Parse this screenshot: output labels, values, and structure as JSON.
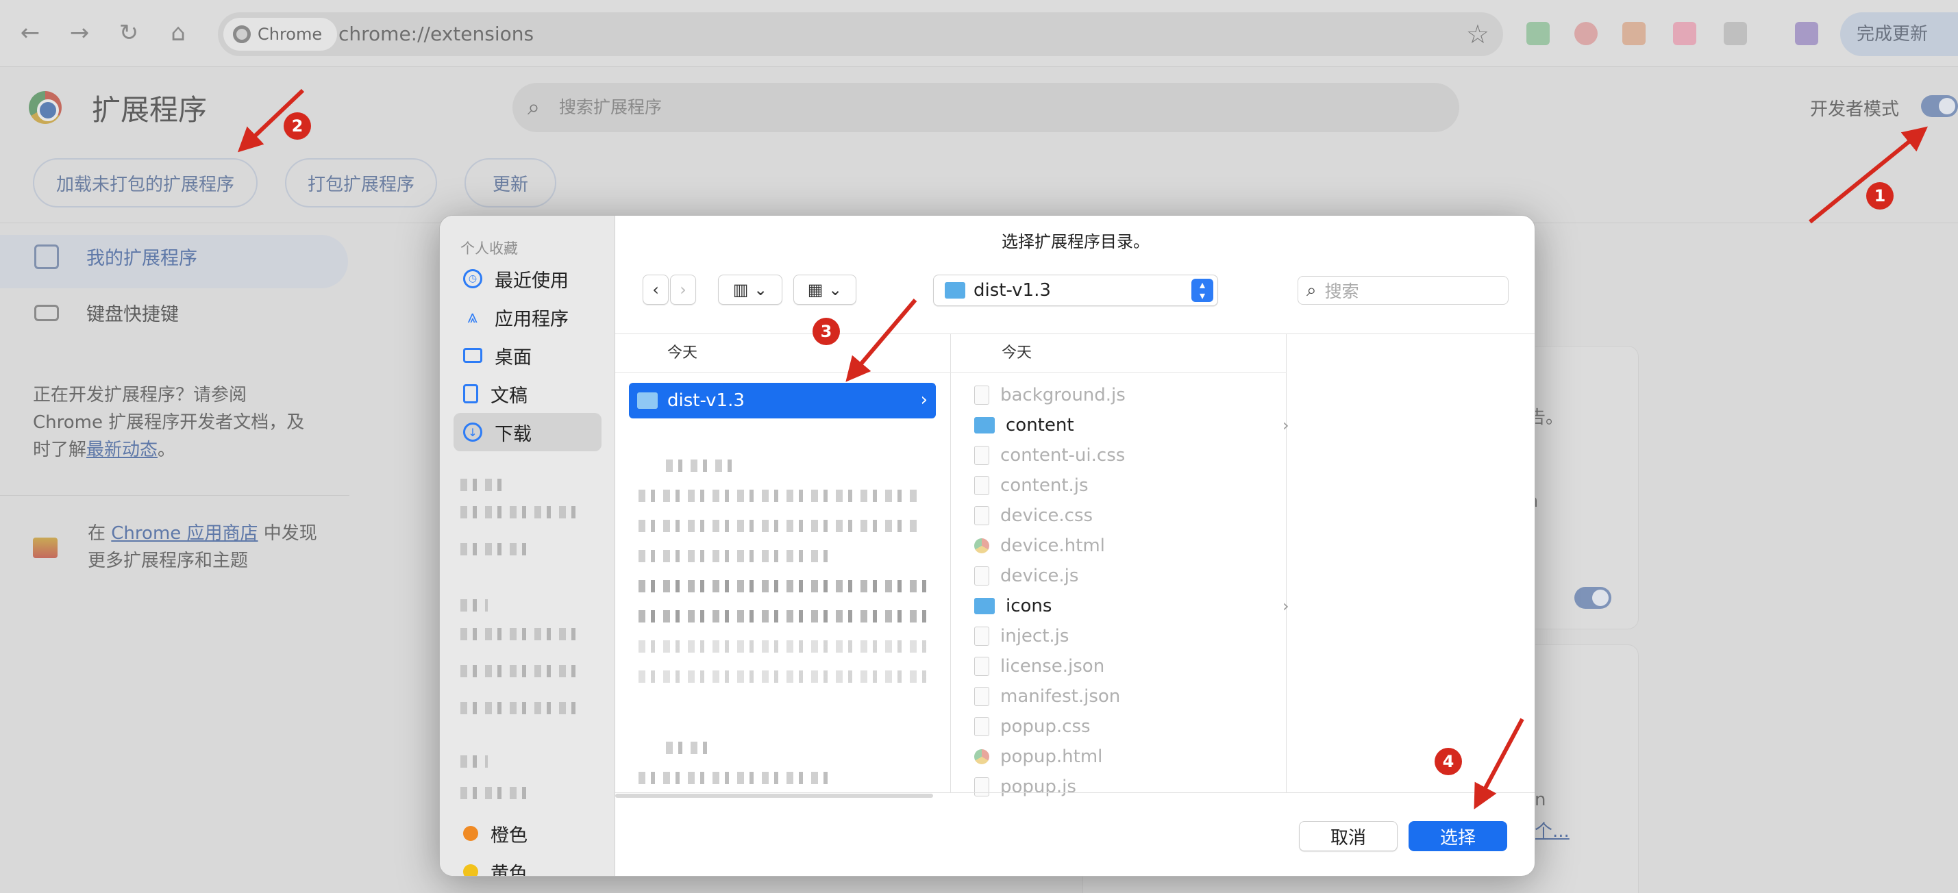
{
  "browser": {
    "chip_label": "Chrome",
    "url": "chrome://extensions",
    "update_button": "完成更新"
  },
  "page": {
    "title": "扩展程序",
    "search_placeholder": "搜索扩展程序",
    "dev_mode_label": "开发者模式",
    "dev_mode_on": true,
    "buttons": {
      "load_unpacked": "加载未打包的扩展程序",
      "pack": "打包扩展程序",
      "update": "更新"
    },
    "sidebar": {
      "my_extensions": "我的扩展程序",
      "shortcuts": "键盘快捷键",
      "dev_text_1": "正在开发扩展程序？请参阅 Chrome 扩展程序开发者文档，及时了解",
      "dev_link": "最新动态",
      "dev_text_2": "。",
      "store_text_1": "在",
      "store_link": "Chrome 应用商店",
      "store_text_2": "中发现更多扩展程序和主题"
    },
    "card_fragments": [
      "广告。",
      "om",
      "n",
      "个..."
    ]
  },
  "dialog": {
    "title": "选择扩展程序目录。",
    "favorites_header": "个人收藏",
    "favorites": [
      {
        "label": "最近使用",
        "icon": "clock-icon"
      },
      {
        "label": "应用程序",
        "icon": "apps-icon"
      },
      {
        "label": "桌面",
        "icon": "desktop-icon"
      },
      {
        "label": "文稿",
        "icon": "document-icon"
      },
      {
        "label": "下载",
        "icon": "download-icon"
      }
    ],
    "tags": [
      {
        "label": "橙色",
        "color": "#f08a24"
      },
      {
        "label": "黄色",
        "color": "#f2c21b"
      }
    ],
    "location": "dist-v1.3",
    "search_placeholder": "搜索",
    "col1_header": "今天",
    "col2_header": "今天",
    "selected_folder": "dist-v1.3",
    "files": [
      {
        "name": "background.js",
        "type": "file"
      },
      {
        "name": "content",
        "type": "folder"
      },
      {
        "name": "content-ui.css",
        "type": "file"
      },
      {
        "name": "content.js",
        "type": "file"
      },
      {
        "name": "device.css",
        "type": "file"
      },
      {
        "name": "device.html",
        "type": "html"
      },
      {
        "name": "device.js",
        "type": "file"
      },
      {
        "name": "icons",
        "type": "folder"
      },
      {
        "name": "inject.js",
        "type": "file"
      },
      {
        "name": "license.json",
        "type": "file"
      },
      {
        "name": "manifest.json",
        "type": "file"
      },
      {
        "name": "popup.css",
        "type": "file"
      },
      {
        "name": "popup.html",
        "type": "html"
      },
      {
        "name": "popup.js",
        "type": "file"
      }
    ],
    "cancel": "取消",
    "select": "选择"
  },
  "annotations": [
    "1",
    "2",
    "3",
    "4"
  ]
}
